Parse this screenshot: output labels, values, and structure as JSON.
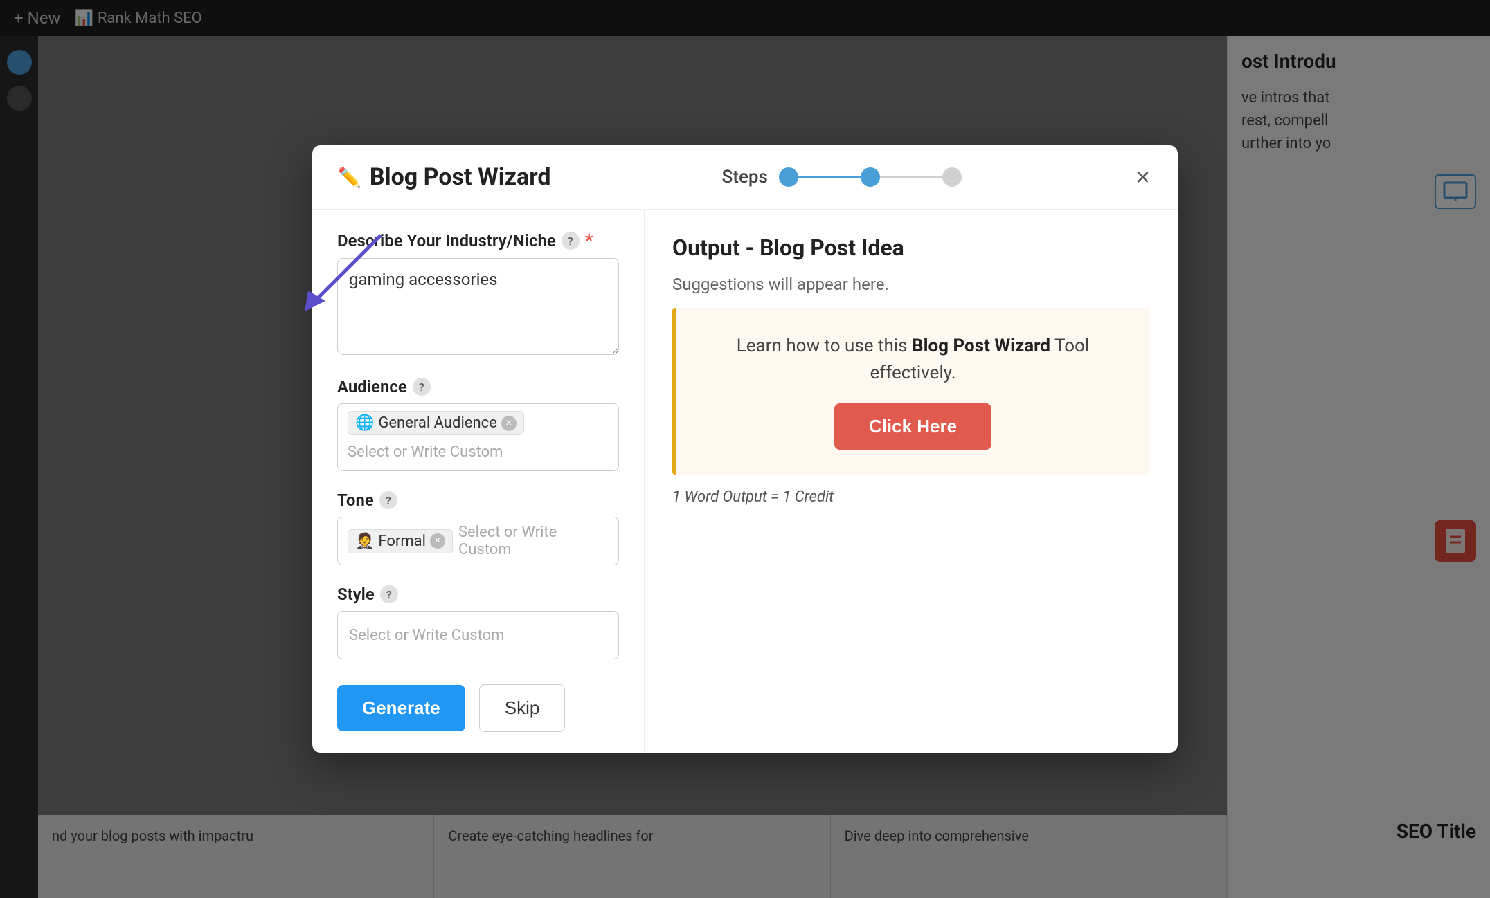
{
  "topbar": {
    "new_label": "+ New",
    "plugin_label": "Rank Math SEO"
  },
  "modal": {
    "title": "Blog Post Wizard",
    "steps_label": "Steps",
    "close_label": "×",
    "fields": {
      "industry": {
        "label": "Describe Your Industry/Niche",
        "required": true,
        "value": "gaming accessories",
        "placeholder": ""
      },
      "audience": {
        "label": "Audience",
        "tags": [
          {
            "emoji": "🌐",
            "text": "General Audience"
          }
        ],
        "placeholder": "Select or Write Custom"
      },
      "tone": {
        "label": "Tone",
        "tags": [
          {
            "emoji": "🤵",
            "text": "Formal"
          }
        ],
        "placeholder": "Select or Write Custom"
      },
      "style": {
        "label": "Style",
        "placeholder": "Select or Write Custom"
      }
    },
    "buttons": {
      "generate": "Generate",
      "skip": "Skip"
    },
    "output": {
      "title": "Output - Blog Post Idea",
      "subtitle": "Suggestions will appear here.",
      "info_text_before": "Learn how to use this ",
      "info_bold": "Blog Post Wizard",
      "info_text_after": " Tool effectively.",
      "click_here": "Click Here",
      "credit_note": "1 Word Output = 1 Credit"
    }
  },
  "right_panel": {
    "title": "ost Introdu",
    "lines": [
      "ve intros that",
      "rest, compell",
      "urther into yo"
    ],
    "seo_title": "SEO Title"
  },
  "bottom_cards": [
    "nd your blog posts with impactru",
    "Create eye-catching headlines for",
    "Dive deep into comprehensive"
  ]
}
